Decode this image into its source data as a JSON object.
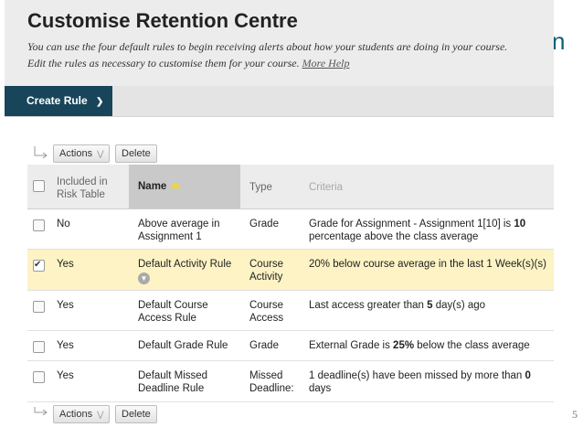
{
  "page": {
    "title": "Customise Retention Centre",
    "description": "You can use the four default rules to begin receiving alerts about how your students are doing in your course.",
    "description_line2": "Edit the rules as necessary to customise them for your course.",
    "help_link": "More Help",
    "slide_edge_text": "n",
    "slide_page_number": "5"
  },
  "toolbar": {
    "create_rule_label": "Create Rule"
  },
  "actions": {
    "actions_label": "Actions",
    "delete_label": "Delete"
  },
  "table": {
    "headers": {
      "included": "Included in Risk Table",
      "name": "Name",
      "type": "Type",
      "criteria": "Criteria"
    },
    "rows": [
      {
        "checked": false,
        "included": "No",
        "name": "Above average in Assignment 1",
        "type": "Grade",
        "criteria_pre": "Grade for Assignment - Assignment 1[10] is ",
        "criteria_bold": "10",
        "criteria_post": " percentage above the class average"
      },
      {
        "checked": true,
        "included": "Yes",
        "name": "Default Activity Rule",
        "type": "Course Activity",
        "criteria_pre": "20% below course average in the last ",
        "criteria_bold": "1",
        "criteria_post": " Week(s)(s)"
      },
      {
        "checked": false,
        "included": "Yes",
        "name": "Default Course Access Rule",
        "type": "Course Access",
        "criteria_pre": "Last access greater than ",
        "criteria_bold": "5",
        "criteria_post": " day(s) ago"
      },
      {
        "checked": false,
        "included": "Yes",
        "name": "Default Grade Rule",
        "type": "Grade",
        "criteria_pre": "External Grade is ",
        "criteria_bold": "25%",
        "criteria_post": " below the class average"
      },
      {
        "checked": false,
        "included": "Yes",
        "name": "Default Missed Deadline Rule",
        "type": "Missed Deadline:",
        "criteria_pre": "1 deadline(s) have been missed by more than ",
        "criteria_bold": "0",
        "criteria_post": " days"
      }
    ]
  },
  "colors": {
    "create_button_bg": "#18455a",
    "selected_row_bg": "#fdf3c4",
    "header_bg": "#ececec"
  }
}
